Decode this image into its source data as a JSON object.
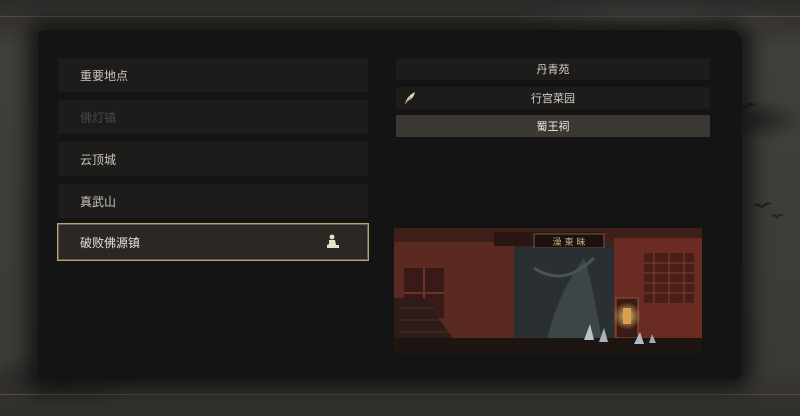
{
  "regions": [
    {
      "label": "重要地点",
      "state": "normal"
    },
    {
      "label": "佛灯镇",
      "state": "locked"
    },
    {
      "label": "云顶城",
      "state": "normal"
    },
    {
      "label": "真武山",
      "state": "normal"
    },
    {
      "label": "破败佛源镇",
      "state": "selected"
    }
  ],
  "sublocations": [
    {
      "label": "丹青苑"
    },
    {
      "label": "行宫菜园"
    },
    {
      "label": "蜀王祠"
    }
  ],
  "preview": {
    "plaque_text": "澡 東 昧"
  },
  "colors": {
    "accent_gold": "#b9a179",
    "panel": "#151414",
    "item_bg": "#1d1c1b",
    "selected_sub_bg": "#3b3834"
  },
  "icons": {
    "selected_region_marker": "seated-figure-icon",
    "sublocation_marker": "feather-icon"
  }
}
